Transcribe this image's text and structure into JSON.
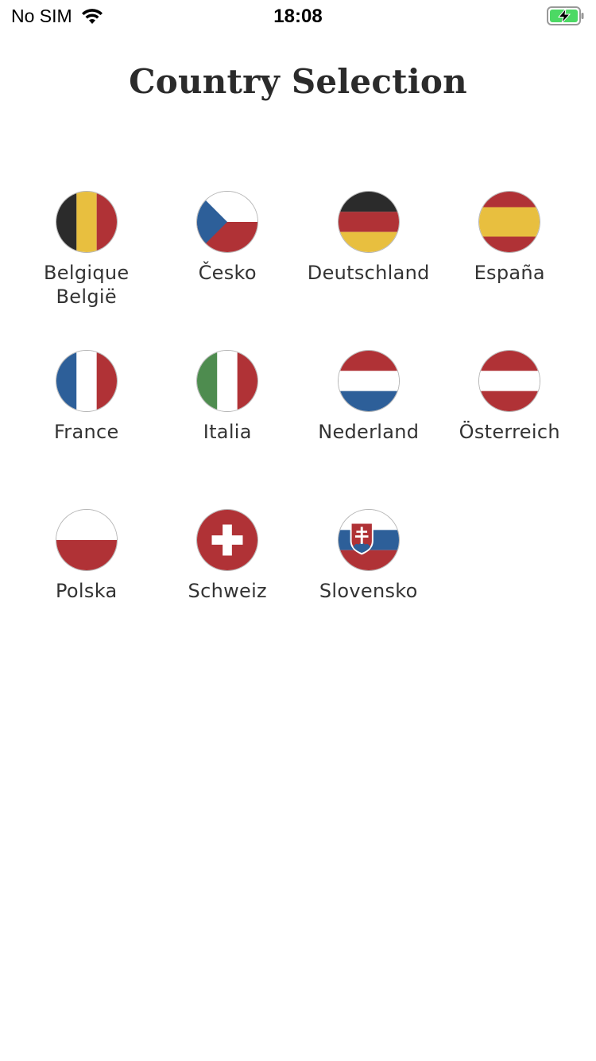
{
  "status_bar": {
    "carrier": "No SIM",
    "time": "18:08",
    "battery_color": "#4cd964"
  },
  "header": {
    "title": "Country Selection"
  },
  "colors": {
    "red": "#b03236",
    "blue": "#2d5f99",
    "black": "#2b2b2b",
    "gold": "#e8bf3f",
    "green": "#4e8c4f",
    "white": "#ffffff"
  },
  "countries": [
    {
      "label": "Belgique\nBelgië",
      "flag_icon": "belgium-flag-icon"
    },
    {
      "label": "Česko",
      "flag_icon": "czech-flag-icon"
    },
    {
      "label": "Deutschland",
      "flag_icon": "germany-flag-icon"
    },
    {
      "label": "España",
      "flag_icon": "spain-flag-icon"
    },
    {
      "label": "France",
      "flag_icon": "france-flag-icon"
    },
    {
      "label": "Italia",
      "flag_icon": "italy-flag-icon"
    },
    {
      "label": "Nederland",
      "flag_icon": "netherlands-flag-icon"
    },
    {
      "label": "Österreich",
      "flag_icon": "austria-flag-icon"
    },
    {
      "label": "Polska",
      "flag_icon": "poland-flag-icon"
    },
    {
      "label": "Schweiz",
      "flag_icon": "switzerland-flag-icon"
    },
    {
      "label": "Slovensko",
      "flag_icon": "slovakia-flag-icon"
    }
  ]
}
